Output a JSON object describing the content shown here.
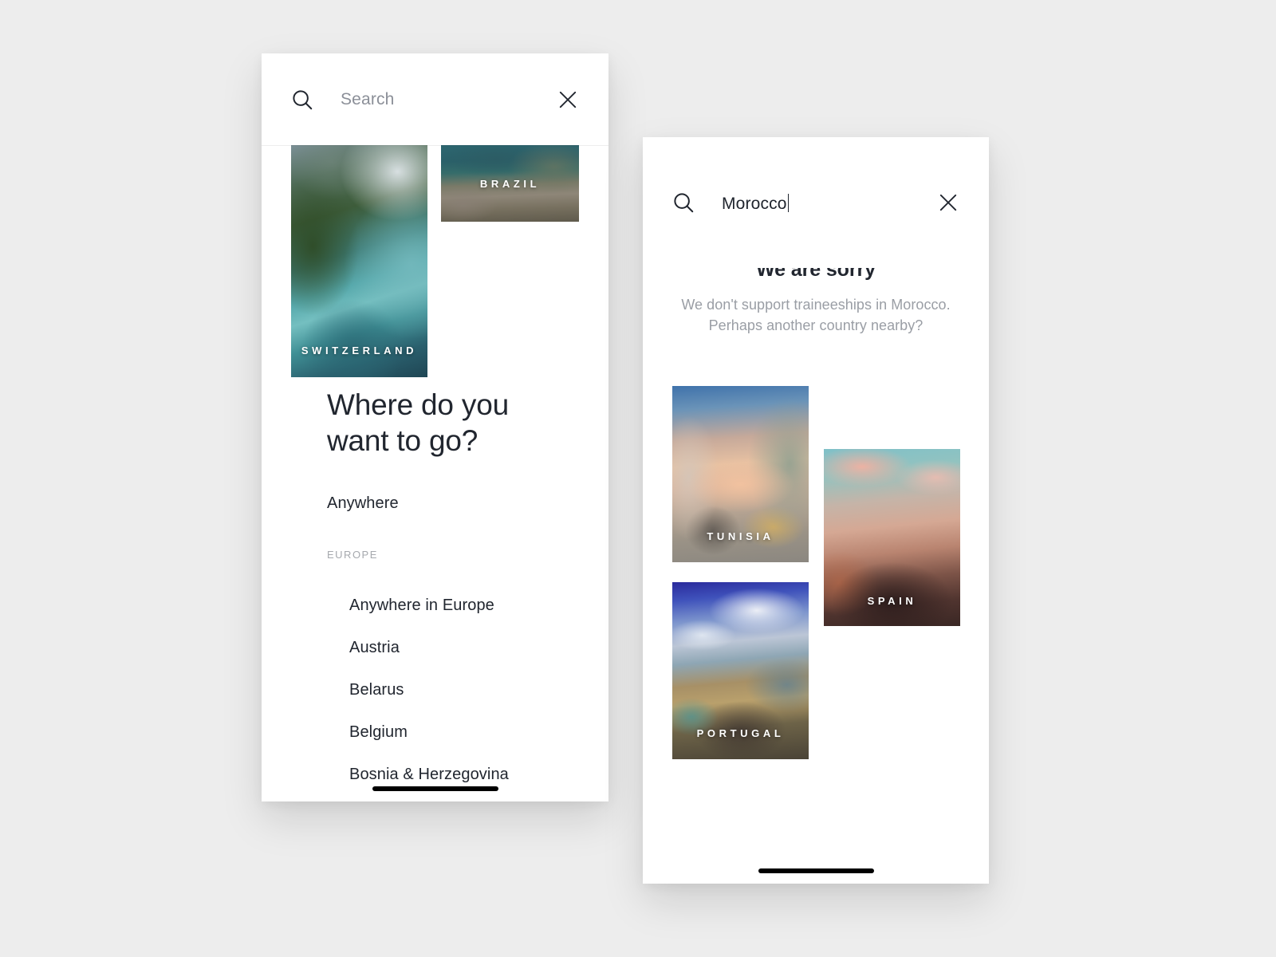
{
  "background_color": "#ededed",
  "screens": {
    "left": {
      "name": "search-browse-screen",
      "search": {
        "placeholder": "Search",
        "value": "",
        "icon": "search-icon",
        "close_icon": "close-icon"
      },
      "cards": [
        {
          "country": "SWITZERLAND",
          "photo": "switzerland-aerial-lake"
        },
        {
          "country": "BRAZIL",
          "photo": "brazil-rio-aerial"
        }
      ],
      "heading": "Where do you want to go?",
      "anywhere_label": "Anywhere",
      "group_label": "EUROPE",
      "countries": [
        "Anywhere in Europe",
        "Austria",
        "Belarus",
        "Belgium",
        "Bosnia & Herzegovina"
      ]
    },
    "right": {
      "name": "no-results-screen",
      "search": {
        "placeholder": "Search",
        "value": "Morocco",
        "icon": "search-icon",
        "close_icon": "close-icon",
        "caret_visible": true
      },
      "empty_state": {
        "title": "We are sorry",
        "body_line_1": "We don't support traineeships in Morocco.",
        "body_line_2": "Perhaps another country nearby?"
      },
      "cards": [
        {
          "country": "TUNISIA",
          "photo": "tunisia-tiled-arches"
        },
        {
          "country": "SPAIN",
          "photo": "spain-tibidabo-basilica"
        },
        {
          "country": "PORTUGAL",
          "photo": "portugal-madeira-cliffs"
        }
      ]
    }
  },
  "colors": {
    "text_primary": "#21262f",
    "text_muted": "#9a9ea5",
    "text_placeholder": "#8b8f98",
    "group_label": "#a6a9ae",
    "card_caption": "#ffffff",
    "surface": "#ffffff"
  }
}
